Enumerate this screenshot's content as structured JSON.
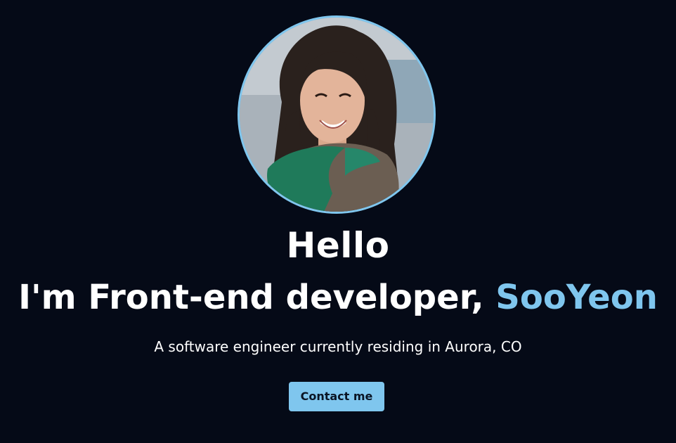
{
  "hero": {
    "greeting": "Hello",
    "headline_prefix": "I'm Front-end developer, ",
    "headline_name": "SooYeon",
    "subtitle": "A software engineer currently residing in Aurora, CO",
    "cta_label": "Contact me"
  },
  "colors": {
    "background": "#050a17",
    "accent": "#7fc6ee",
    "text": "#ffffff"
  },
  "icons": {
    "avatar": "profile-photo"
  }
}
